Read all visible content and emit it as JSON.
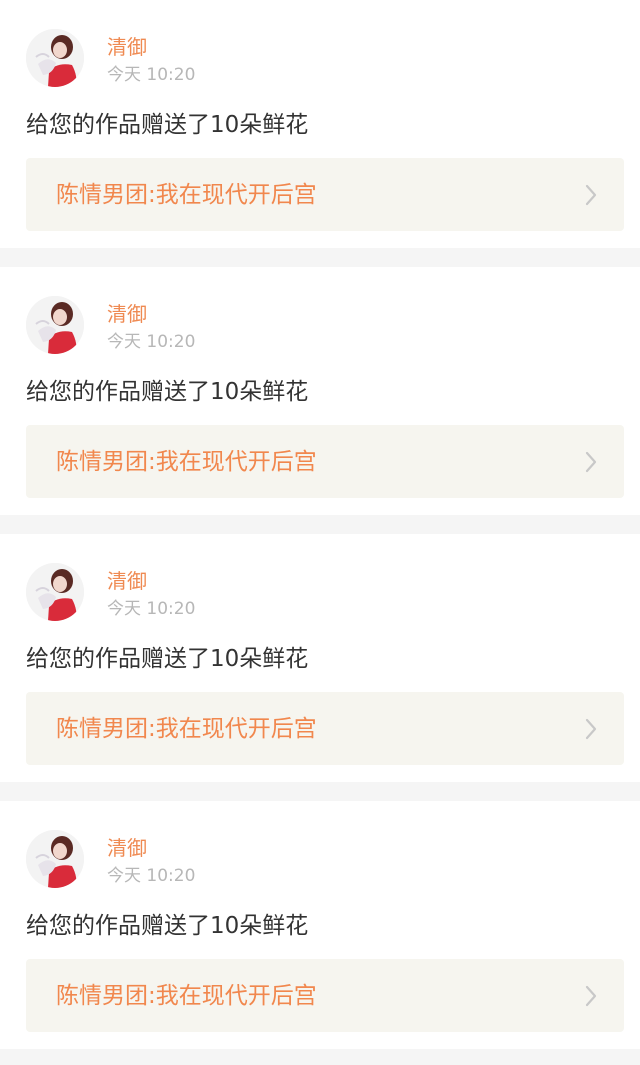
{
  "notifications": [
    {
      "username": "清御",
      "time": "今天 10:20",
      "message": "给您的作品赠送了10朵鲜花",
      "work_title": "陈情男团:我在现代开后宫",
      "avatar_icon": "user-avatar",
      "chevron_icon": "chevron-right-icon"
    },
    {
      "username": "清御",
      "time": "今天 10:20",
      "message": "给您的作品赠送了10朵鲜花",
      "work_title": "陈情男团:我在现代开后宫",
      "avatar_icon": "user-avatar",
      "chevron_icon": "chevron-right-icon"
    },
    {
      "username": "清御",
      "time": "今天 10:20",
      "message": "给您的作品赠送了10朵鲜花",
      "work_title": "陈情男团:我在现代开后宫",
      "avatar_icon": "user-avatar",
      "chevron_icon": "chevron-right-icon"
    },
    {
      "username": "清御",
      "time": "今天 10:20",
      "message": "给您的作品赠送了10朵鲜花",
      "work_title": "陈情男团:我在现代开后宫",
      "avatar_icon": "user-avatar",
      "chevron_icon": "chevron-right-icon"
    }
  ],
  "colors": {
    "page_background": "#f5f5f5",
    "card_background": "#ffffff",
    "username": "#ef8a52",
    "time": "#b7b7b7",
    "message": "#333333",
    "work_link_background": "#f6f5ef",
    "work_title": "#f1874d",
    "chevron": "#c8c8c8"
  }
}
